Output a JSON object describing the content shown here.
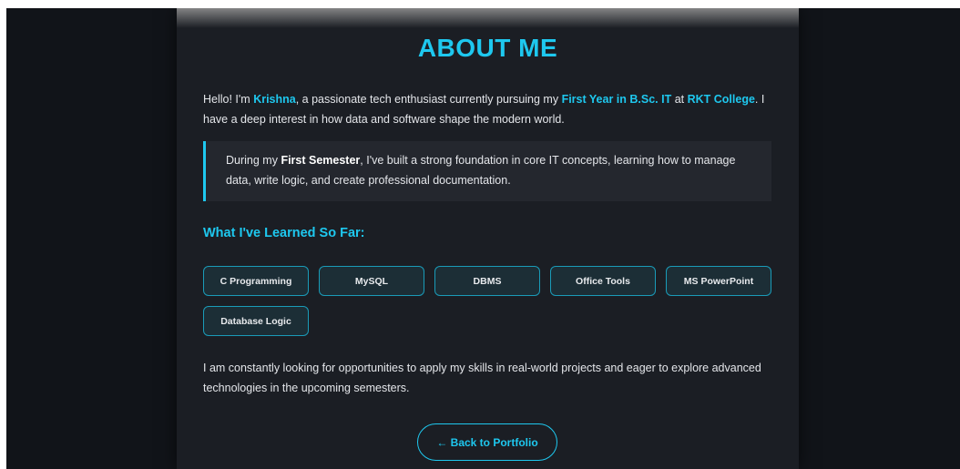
{
  "page": {
    "title": "ABOUT ME"
  },
  "intro": {
    "t1": "Hello! I'm ",
    "name": "Krishna",
    "t2": ", a passionate tech enthusiast currently pursuing my ",
    "year": "First Year in B.Sc. IT",
    "t3": " at ",
    "college": "RKT College",
    "t4": ". I have a deep interest in how data and software shape the modern world."
  },
  "quote": {
    "t1": "During my ",
    "semester": "First Semester",
    "t2": ", I've built a strong foundation in core IT concepts, learning how to manage data, write logic, and create professional documentation."
  },
  "skills": {
    "heading": "What I've Learned So Far:",
    "items": [
      "C Programming",
      "MySQL",
      "DBMS",
      "Office Tools",
      "MS PowerPoint",
      "Database Logic"
    ]
  },
  "closing": {
    "text": "I am constantly looking for opportunities to apply my skills in real-world projects and eager to explore advanced technologies in the upcoming semesters."
  },
  "back_button": {
    "label": "← Back to Portfolio"
  },
  "colors": {
    "accent": "#1ec8ef",
    "background": "#111419",
    "card": "#1b1e24"
  }
}
